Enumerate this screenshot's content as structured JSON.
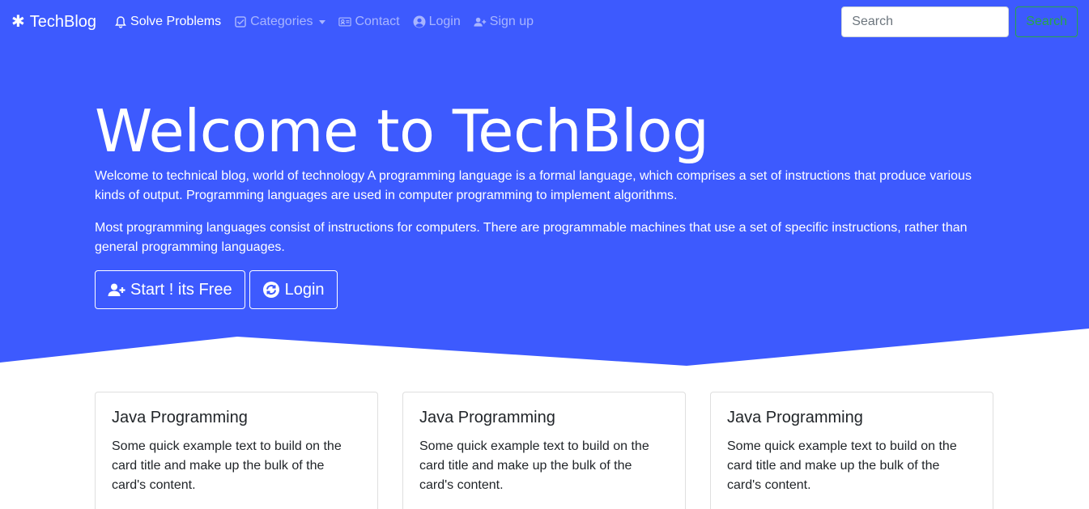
{
  "navbar": {
    "brand": "TechBlog",
    "items": [
      {
        "label": "Solve Problems",
        "icon": "bell-icon",
        "active": true
      },
      {
        "label": "Categories",
        "icon": "check-square-icon",
        "active": false
      },
      {
        "label": "Contact",
        "icon": "address-card-icon",
        "active": false
      },
      {
        "label": "Login",
        "icon": "user-circle-icon",
        "active": false
      },
      {
        "label": "Sign up",
        "icon": "user-plus-icon",
        "active": false
      }
    ],
    "search_placeholder": "Search",
    "search_button": "Search"
  },
  "hero": {
    "title": "Welcome to TechBlog",
    "paragraph1": "Welcome to technical blog, world of technology A programming language is a formal language, which comprises a set of instructions that produce various kinds of output. Programming languages are used in computer programming to implement algorithms.",
    "paragraph2": "Most programming languages consist of instructions for computers. There are programmable machines that use a set of specific instructions, rather than general programming languages.",
    "start_button": "Start ! its Free",
    "login_button": "Login"
  },
  "cards": [
    {
      "title": "Java Programming",
      "text": "Some quick example text to build on the card title and make up the bulk of the card's content."
    },
    {
      "title": "Java Programming",
      "text": "Some quick example text to build on the card title and make up the bulk of the card's content."
    },
    {
      "title": "Java Programming",
      "text": "Some quick example text to build on the card title and make up the bulk of the card's content."
    }
  ],
  "colors": {
    "primary": "#3d5afe",
    "success": "#28a745",
    "text": "#212529"
  }
}
